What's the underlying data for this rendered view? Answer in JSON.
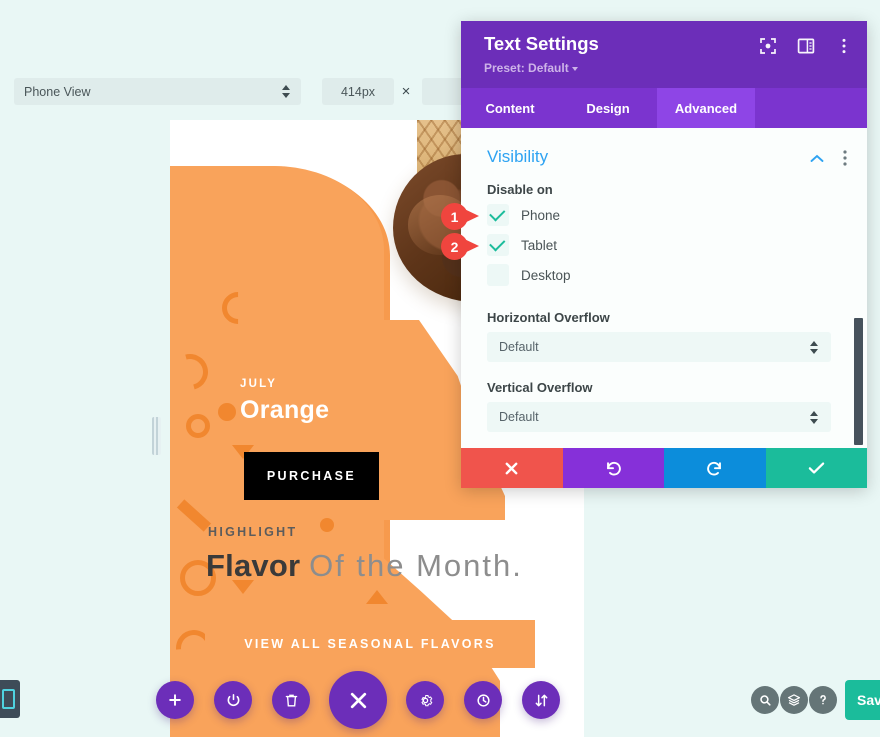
{
  "toolbar": {
    "view_select": {
      "value": "Phone View",
      "icon": "stepper-icon"
    },
    "width_value": "414px",
    "separator": "×",
    "height_value": ""
  },
  "preview": {
    "eyebrow": "JULY",
    "product_title": "Orange",
    "purchase_button": "PURCHASE",
    "highlight_label": "HIGHLIGHT",
    "headline_strong": "Flavor",
    "headline_rest": "Of the Month.",
    "cta_button": "VIEW ALL SEASONAL FLAVORS"
  },
  "modal": {
    "title": "Text Settings",
    "preset": "Preset: Default",
    "header_icons": [
      "focus-target-icon",
      "layout-panel-icon",
      "vertical-dots-icon"
    ],
    "tabs": [
      {
        "label": "Content",
        "active": false
      },
      {
        "label": "Design",
        "active": false
      },
      {
        "label": "Advanced",
        "active": true
      }
    ],
    "section": {
      "title": "Visibility",
      "collapse_icon": "chevron-up-icon",
      "more_icon": "vertical-dots-icon"
    },
    "disable_on_label": "Disable on",
    "checkboxes": [
      {
        "label": "Phone",
        "checked": true
      },
      {
        "label": "Tablet",
        "checked": true
      },
      {
        "label": "Desktop",
        "checked": false
      }
    ],
    "horizontal_overflow": {
      "label": "Horizontal Overflow",
      "value": "Default"
    },
    "vertical_overflow": {
      "label": "Vertical Overflow",
      "value": "Default"
    },
    "footer": [
      {
        "name": "cancel",
        "icon": "close-x-icon"
      },
      {
        "name": "undo",
        "icon": "undo-arrow-icon"
      },
      {
        "name": "redo",
        "icon": "redo-arrow-icon"
      },
      {
        "name": "save",
        "icon": "checkmark-icon"
      }
    ]
  },
  "annotations": [
    {
      "number": "1",
      "target": "Phone"
    },
    {
      "number": "2",
      "target": "Tablet"
    }
  ],
  "bottom_bar": {
    "buttons": [
      {
        "name": "add",
        "icon": "plus-icon"
      },
      {
        "name": "power",
        "icon": "power-icon"
      },
      {
        "name": "trash",
        "icon": "trash-icon"
      },
      {
        "name": "close",
        "icon": "close-x-icon"
      },
      {
        "name": "settings",
        "icon": "gear-icon"
      },
      {
        "name": "history",
        "icon": "clock-icon"
      },
      {
        "name": "sort",
        "icon": "up-down-arrows-icon"
      }
    ],
    "utility_buttons": [
      {
        "name": "search",
        "icon": "magnifier-icon"
      },
      {
        "name": "layers",
        "icon": "layers-icon"
      },
      {
        "name": "help",
        "icon": "question-mark-icon"
      }
    ],
    "save_label": "Save"
  },
  "colors": {
    "background": "#e9f7f5",
    "modal_header": "#6c2eb9",
    "tab_bar": "#7b34cf",
    "tab_active": "#8e45e6",
    "section_title": "#2ea3f2",
    "accent_teal": "#1bbc9b",
    "accent_red": "#f0453e",
    "accent_blue": "#0c8ddb",
    "brand_orange": "#f9a35b"
  }
}
